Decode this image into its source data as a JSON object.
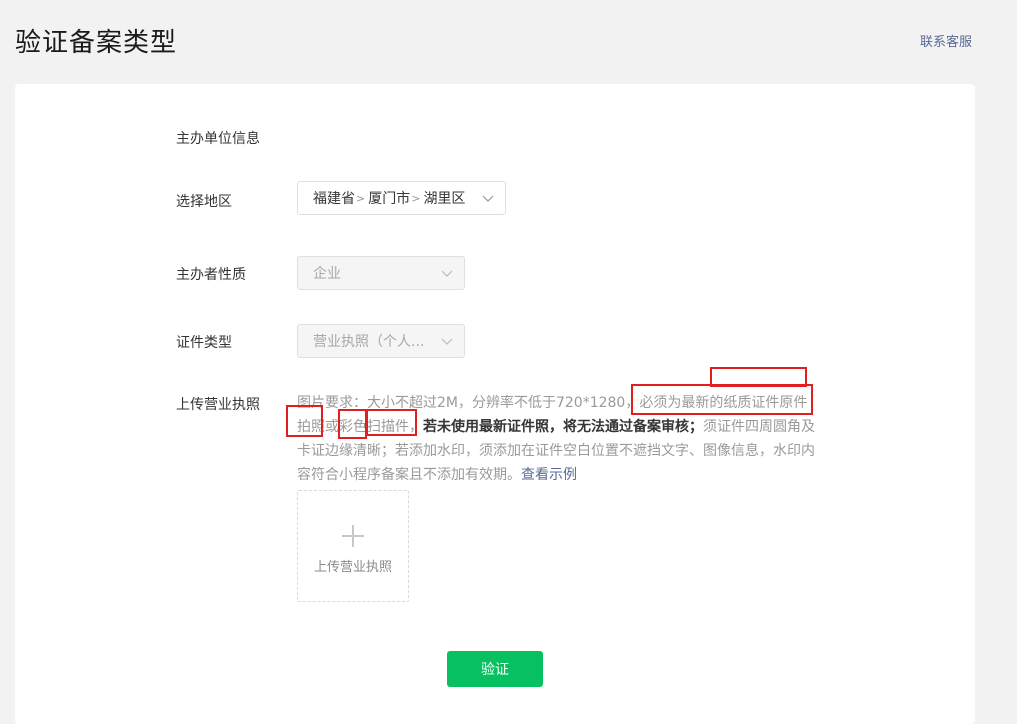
{
  "header": {
    "title": "验证备案类型",
    "support_link": "联系客服"
  },
  "form": {
    "section_title": "主办单位信息",
    "region": {
      "label": "选择地区",
      "province": "福建省",
      "city": "厦门市",
      "district": "湖里区",
      "separator": ">"
    },
    "nature": {
      "label": "主办者性质",
      "value": "企业"
    },
    "cert_type": {
      "label": "证件类型",
      "value": "营业执照（个人..."
    },
    "license": {
      "label": "上传营业执照",
      "hint_1": "图片要求：大小不超过2M，分辨率不低于720*1280，必须为最新的纸质证件原件拍照或彩色扫描件，",
      "hint_bold": "若未使用最新证件照，将无法通过备案审核；",
      "hint_2": "须证件四周圆角及卡证边缘清晰；若添加水印，须添加在证件空白位置不遮挡文字、图像信息，水印内容符合小程序备案且不添加有效期。",
      "example_link": "查看示例",
      "upload_label": "上传营业执照"
    },
    "submit_label": "验证"
  },
  "colors": {
    "primary_green": "#07c160",
    "link_blue": "#576b95",
    "annotation_red": "#e02020"
  }
}
